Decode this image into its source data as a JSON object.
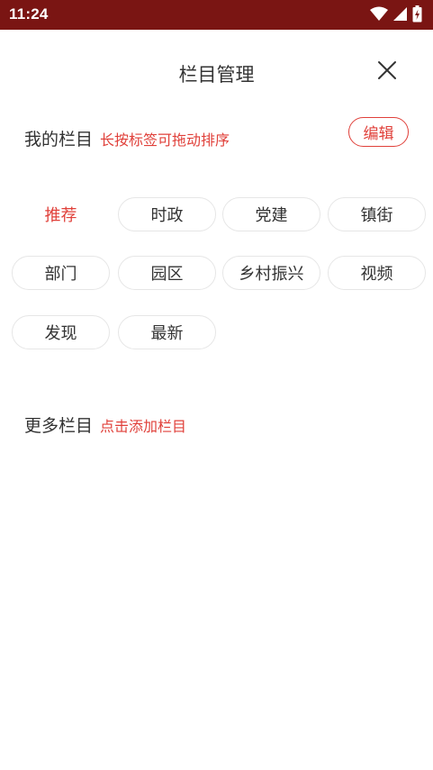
{
  "status_bar": {
    "time": "11:24",
    "icons": [
      "wifi-icon",
      "cellular-signal-icon",
      "battery-charging-icon"
    ],
    "color": "#7a1513"
  },
  "header": {
    "title": "栏目管理",
    "close_icon": "close-icon"
  },
  "my_channels": {
    "title": "我的栏目",
    "hint": "长按标签可拖动排序",
    "edit_label": "编辑",
    "tags": [
      {
        "label": "推荐",
        "active": true
      },
      {
        "label": "时政",
        "active": false
      },
      {
        "label": "党建",
        "active": false
      },
      {
        "label": "镇街",
        "active": false
      },
      {
        "label": "部门",
        "active": false
      },
      {
        "label": "园区",
        "active": false
      },
      {
        "label": "乡村振兴",
        "active": false
      },
      {
        "label": "视频",
        "active": false
      },
      {
        "label": "发现",
        "active": false
      },
      {
        "label": "最新",
        "active": false
      }
    ]
  },
  "more_channels": {
    "title": "更多栏目",
    "hint": "点击添加栏目"
  },
  "colors": {
    "accent": "#e0403a",
    "text": "#333333",
    "tag_border": "#e6e6e6"
  }
}
